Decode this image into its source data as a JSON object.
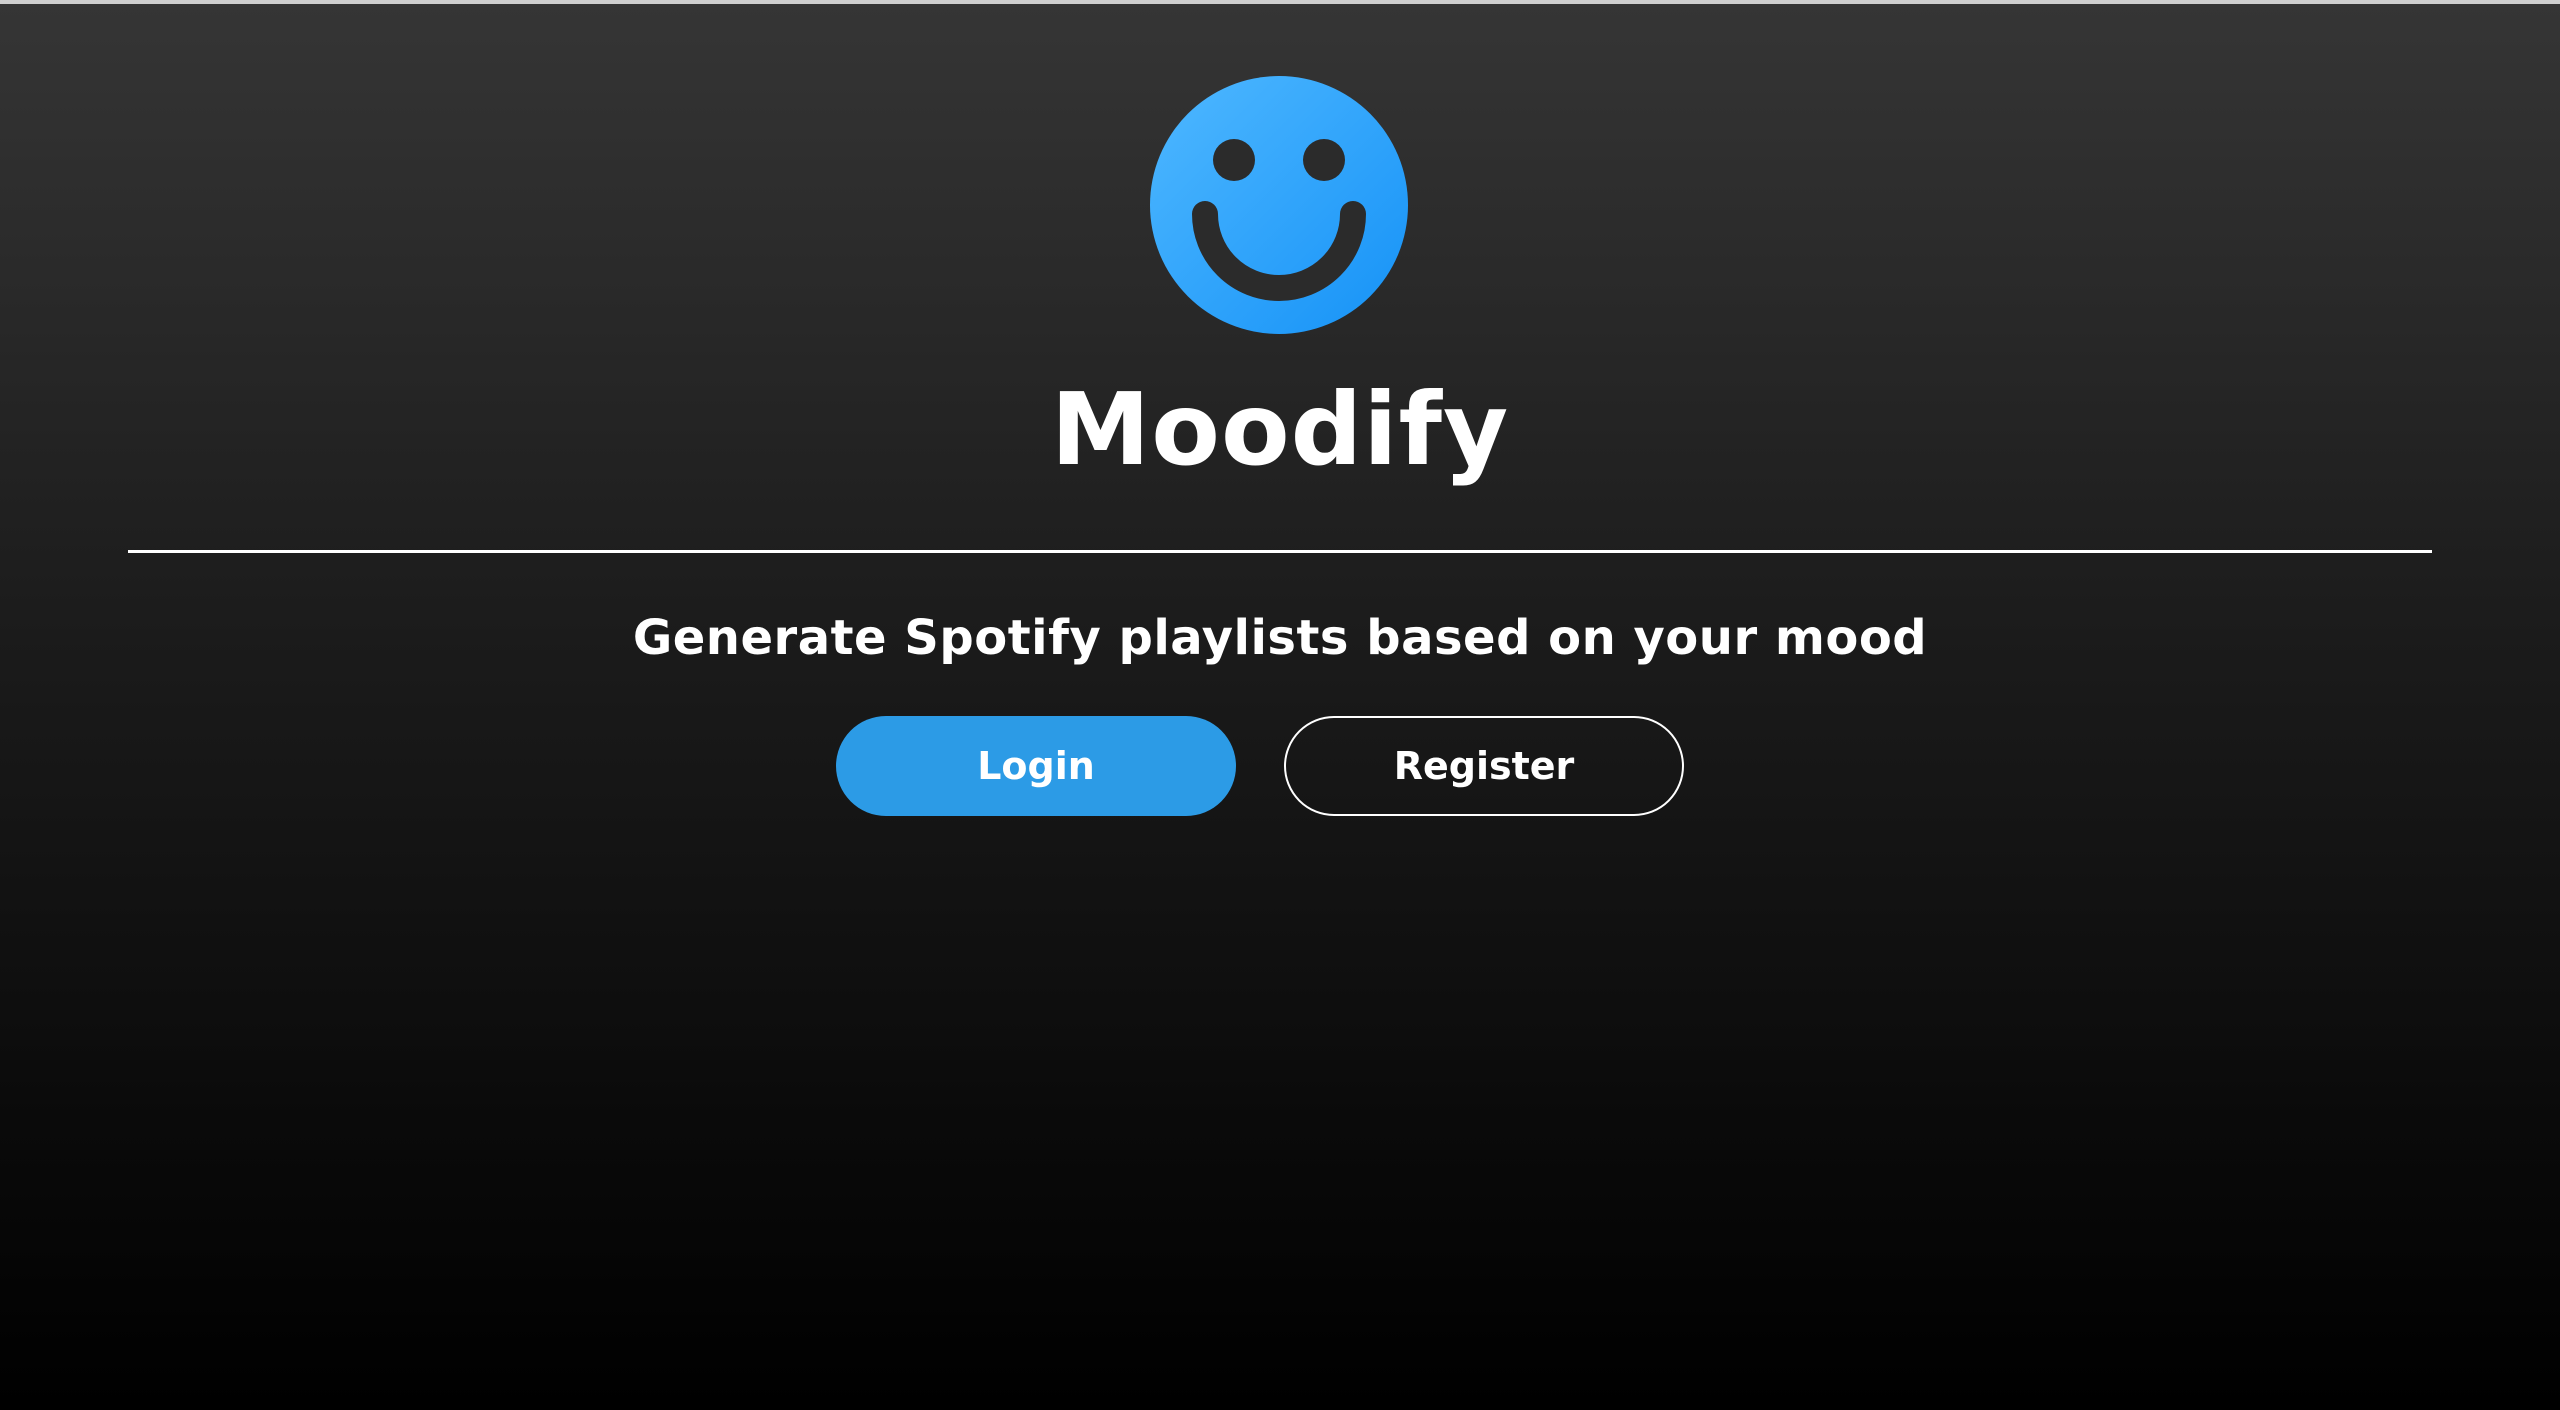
{
  "app": {
    "title": "Moodify",
    "logo_icon": "smiley-face-icon",
    "logo_color": "#1e9bf5"
  },
  "tagline": "Generate Spotify playlists based on your mood",
  "actions": {
    "login_label": "Login",
    "register_label": "Register"
  },
  "colors": {
    "accent": "#2c9be6",
    "background_top": "#353535",
    "background_bottom": "#000000",
    "text": "#ffffff"
  }
}
